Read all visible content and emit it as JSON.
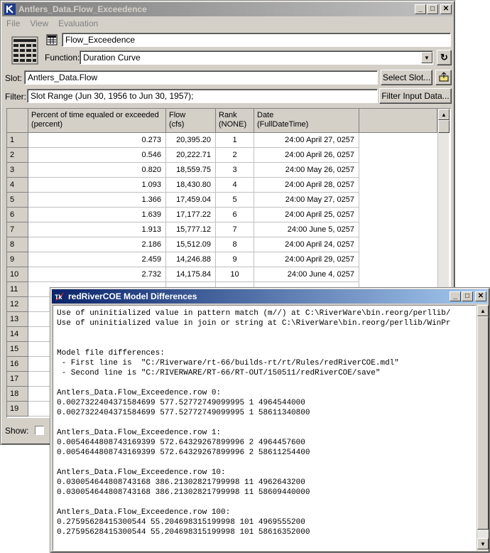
{
  "main_window": {
    "title": "Antlers_Data.Flow_Exceedence",
    "menu": [
      "File",
      "View",
      "Evaluation"
    ],
    "name_field": "Flow_Exceedence",
    "function_label": "Function:",
    "function_value": "Duration Curve",
    "slot_label": "Slot:",
    "slot_value": "Antlers_Data.Flow",
    "select_slot_button": "Select Slot...",
    "filter_label": "Filter:",
    "filter_value": "Slot Range (Jun 30, 1956 to Jun 30, 1957);",
    "filter_button": "Filter Input Data...",
    "show_label": "Show:",
    "table": {
      "columns": [
        "Percent of time equaled or exceeded\n(percent)",
        "Flow\n(cfs)",
        "Rank\n(NONE)",
        "Date\n(FullDateTime)"
      ],
      "rows": [
        {
          "n": "1",
          "pct": "0.273",
          "flow": "20,395.20",
          "rank": "1",
          "date": "24:00 April 27, 0257"
        },
        {
          "n": "2",
          "pct": "0.546",
          "flow": "20,222.71",
          "rank": "2",
          "date": "24:00 April 26, 0257"
        },
        {
          "n": "3",
          "pct": "0.820",
          "flow": "18,559.75",
          "rank": "3",
          "date": "24:00 May 26, 0257"
        },
        {
          "n": "4",
          "pct": "1.093",
          "flow": "18,430.80",
          "rank": "4",
          "date": "24:00 April 28, 0257"
        },
        {
          "n": "5",
          "pct": "1.366",
          "flow": "17,459.04",
          "rank": "5",
          "date": "24:00 May 27, 0257"
        },
        {
          "n": "6",
          "pct": "1.639",
          "flow": "17,177.22",
          "rank": "6",
          "date": "24:00 April 25, 0257"
        },
        {
          "n": "7",
          "pct": "1.913",
          "flow": "15,777.12",
          "rank": "7",
          "date": "24:00 June 5, 0257"
        },
        {
          "n": "8",
          "pct": "2.186",
          "flow": "15,512.09",
          "rank": "8",
          "date": "24:00 April 24, 0257"
        },
        {
          "n": "9",
          "pct": "2.459",
          "flow": "14,246.88",
          "rank": "9",
          "date": "24:00 April 29, 0257"
        },
        {
          "n": "10",
          "pct": "2.732",
          "flow": "14,175.84",
          "rank": "10",
          "date": "24:00 June 4, 0257"
        },
        {
          "n": "11",
          "pct": "",
          "flow": "",
          "rank": "",
          "date": ""
        },
        {
          "n": "12",
          "pct": "",
          "flow": "",
          "rank": "",
          "date": ""
        },
        {
          "n": "13",
          "pct": "",
          "flow": "",
          "rank": "",
          "date": ""
        },
        {
          "n": "14",
          "pct": "",
          "flow": "",
          "rank": "",
          "date": ""
        },
        {
          "n": "15",
          "pct": "",
          "flow": "",
          "rank": "",
          "date": ""
        },
        {
          "n": "16",
          "pct": "",
          "flow": "",
          "rank": "",
          "date": ""
        },
        {
          "n": "17",
          "pct": "",
          "flow": "",
          "rank": "",
          "date": ""
        },
        {
          "n": "18",
          "pct": "",
          "flow": "",
          "rank": "",
          "date": ""
        },
        {
          "n": "19",
          "pct": "",
          "flow": "",
          "rank": "",
          "date": ""
        }
      ]
    }
  },
  "diff_window": {
    "title": "redRiverCOE Model Differences",
    "lines": [
      "Use of uninitialized value in pattern match (m//) at C:\\RiverWare\\bin.reorg/perllib/",
      "Use of uninitialized value in join or string at C:\\RiverWare\\bin.reorg/perllib/WinPr",
      "",
      "",
      "Model file differences:",
      " - First line is  \"C:/Riverware/rt-66/builds-rt/rt/Rules/redRiverCOE.mdl\"",
      " - Second line is \"C:/RIVERWARE/RT-66/RT-OUT/150511/redRiverCOE/save\"",
      "",
      "Antlers_Data.Flow_Exceedence.row 0:",
      "0.0027322404371584699 577.52772749099995 1 4964544000",
      "0.0027322404371584699 577.52772749099995 1 58611340800",
      "",
      "Antlers_Data.Flow_Exceedence.row 1:",
      "0.0054644808743169399 572.64329267899996 2 4964457600",
      "0.0054644808743169399 572.64329267899996 2 58611254400",
      "",
      "Antlers_Data.Flow_Exceedence.row 10:",
      "0.030054644808743168 386.21302821799998 11 4962643200",
      "0.030054644808743168 386.21302821799998 11 58609440000",
      "",
      "Antlers_Data.Flow_Exceedence.row 100:",
      "0.27595628415300544 55.204698315199998 101 4969555200",
      "0.27595628415300544 55.204698315199998 101 58616352000"
    ]
  }
}
